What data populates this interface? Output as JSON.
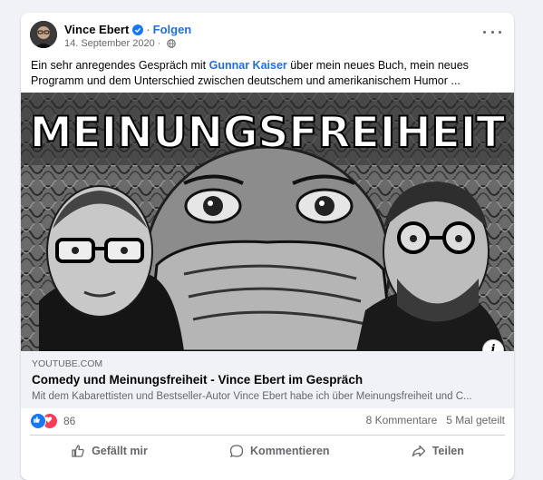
{
  "post": {
    "author": "Vince Ebert",
    "separator": "·",
    "follow_label": "Folgen",
    "date": "14. September 2020",
    "date_separator": "·",
    "text_before": "Ein sehr anregendes Gespräch mit ",
    "mention": "Gunnar Kaiser",
    "text_after": " über mein neues Buch, mein neues Programm und dem Unterschied zwischen deutschem und amerikanischem Humor ...",
    "image_title": "MEINUNGSFREIHEIT"
  },
  "link": {
    "domain": "YOUTUBE.COM",
    "title": "Comedy und Meinungsfreiheit - Vince Ebert im Gespräch",
    "description": "Mit dem Kabarettisten und Bestseller-Autor Vince Ebert habe ich über Meinungsfreiheit und C...",
    "info_glyph": "i"
  },
  "stats": {
    "reaction_count": "86",
    "comments": "8 Kommentare",
    "shares": "5 Mal geteilt"
  },
  "actions": {
    "like": "Gefällt mir",
    "comment": "Kommentieren",
    "share": "Teilen"
  },
  "colors": {
    "link_blue": "#216fdb",
    "like_blue": "#1877f2",
    "love_red": "#f33e58",
    "secondary_text": "#65676b"
  }
}
